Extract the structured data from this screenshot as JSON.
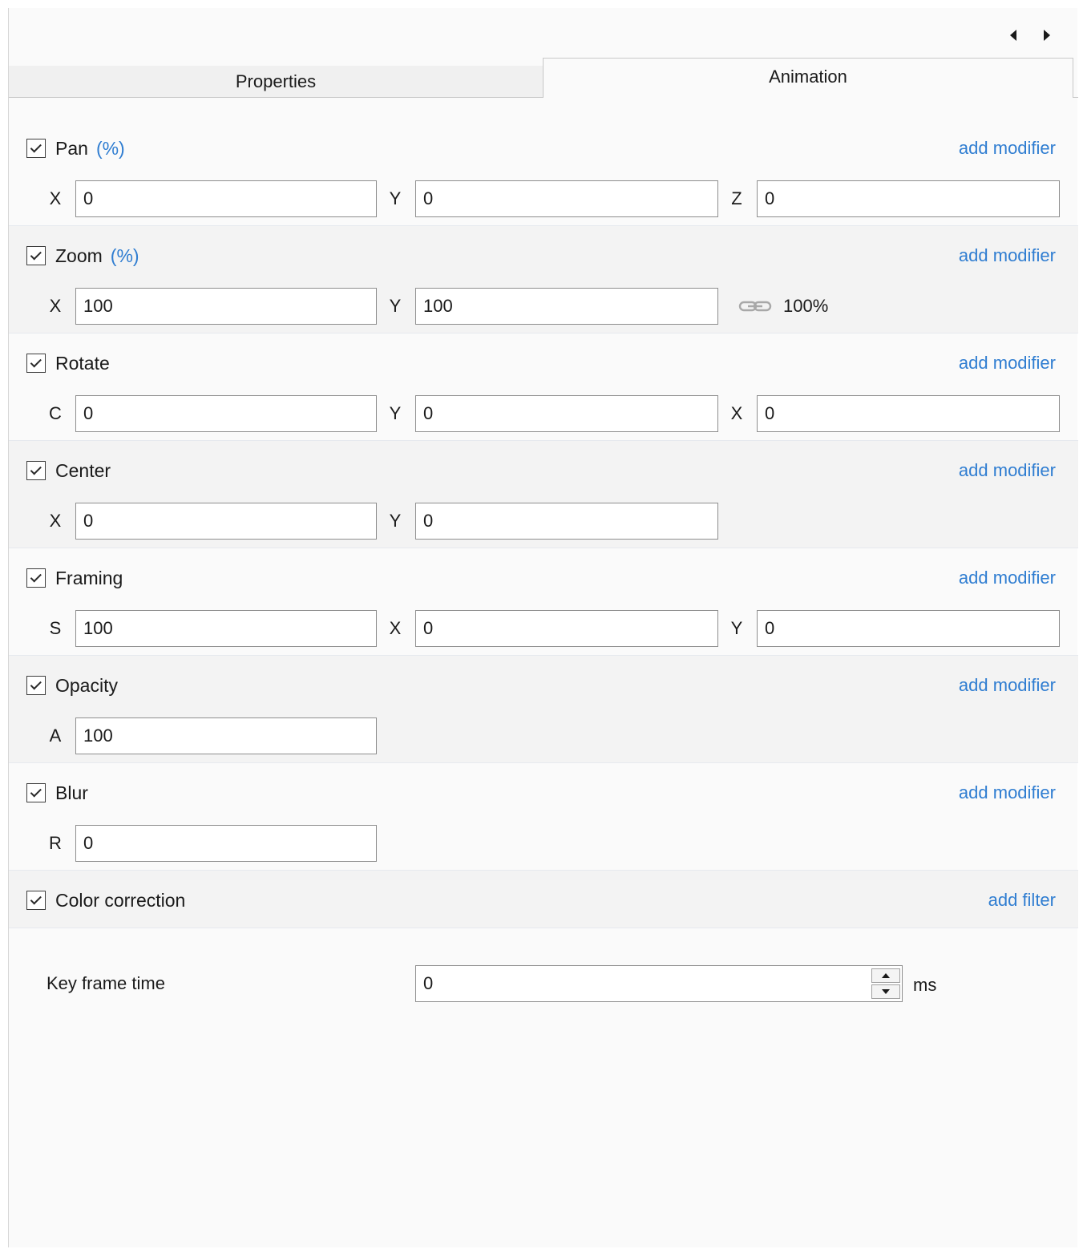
{
  "nav": {
    "prev_icon": "caret-left-icon",
    "next_icon": "caret-right-icon"
  },
  "tabs": [
    {
      "label": "Properties",
      "active": false
    },
    {
      "label": "Animation",
      "active": true
    }
  ],
  "colors": {
    "link": "#2f7dd1",
    "panel_bg": "#fafafa",
    "alt_row_bg": "#f3f3f3"
  },
  "sections": {
    "pan": {
      "checked": true,
      "title": "Pan",
      "unit": "(%)",
      "action": "add modifier",
      "fields": [
        {
          "label": "X",
          "value": "0"
        },
        {
          "label": "Y",
          "value": "0"
        },
        {
          "label": "Z",
          "value": "0"
        }
      ]
    },
    "zoom": {
      "checked": true,
      "title": "Zoom",
      "unit": "(%)",
      "action": "add modifier",
      "fields": [
        {
          "label": "X",
          "value": "100"
        },
        {
          "label": "Y",
          "value": "100"
        }
      ],
      "link_icon": "chain-link-icon",
      "ratio": "100%"
    },
    "rotate": {
      "checked": true,
      "title": "Rotate",
      "action": "add modifier",
      "fields": [
        {
          "label": "C",
          "value": "0"
        },
        {
          "label": "Y",
          "value": "0"
        },
        {
          "label": "X",
          "value": "0"
        }
      ]
    },
    "center": {
      "checked": true,
      "title": "Center",
      "action": "add modifier",
      "fields": [
        {
          "label": "X",
          "value": "0"
        },
        {
          "label": "Y",
          "value": "0"
        }
      ]
    },
    "framing": {
      "checked": true,
      "title": "Framing",
      "action": "add modifier",
      "fields": [
        {
          "label": "S",
          "value": "100"
        },
        {
          "label": "X",
          "value": "0"
        },
        {
          "label": "Y",
          "value": "0"
        }
      ]
    },
    "opacity": {
      "checked": true,
      "title": "Opacity",
      "action": "add modifier",
      "fields": [
        {
          "label": "A",
          "value": "100"
        }
      ]
    },
    "blur": {
      "checked": true,
      "title": "Blur",
      "action": "add modifier",
      "fields": [
        {
          "label": "R",
          "value": "0"
        }
      ]
    },
    "color_correction": {
      "checked": true,
      "title": "Color correction",
      "action": "add filter"
    }
  },
  "key_frame": {
    "label": "Key frame time",
    "value": "0",
    "unit": "ms"
  }
}
